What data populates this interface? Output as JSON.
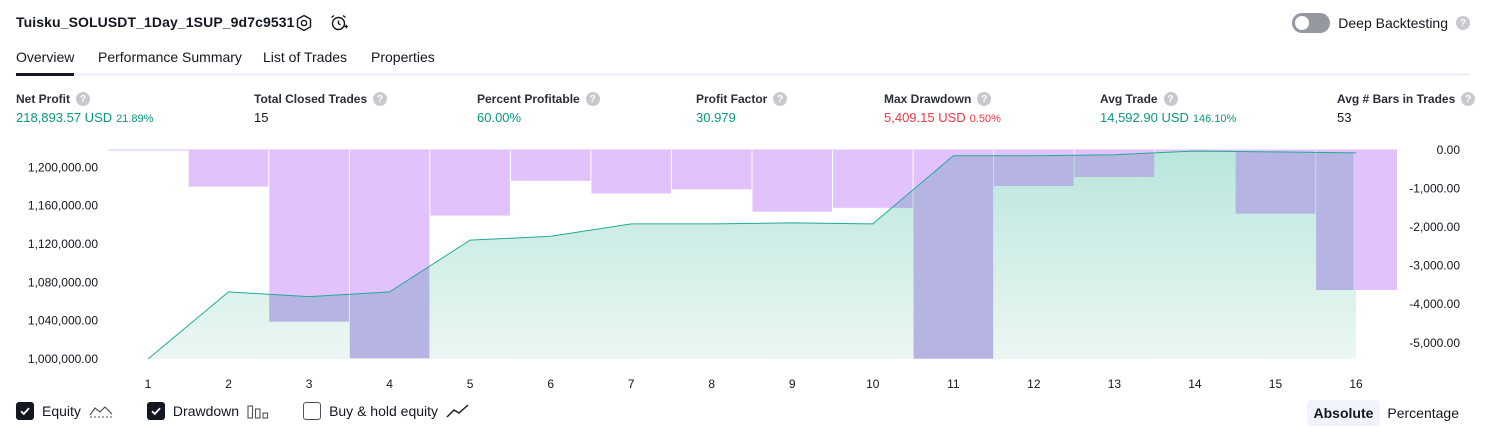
{
  "header": {
    "title": "Tuisku_SOLUSDT_1Day_1SUP_9d7c9531",
    "deep_backtesting_label": "Deep Backtesting",
    "help_glyph": "?"
  },
  "tabs": [
    {
      "label": "Overview"
    },
    {
      "label": "Performance Summary"
    },
    {
      "label": "List of Trades"
    },
    {
      "label": "Properties"
    }
  ],
  "metrics": [
    {
      "label": "Net Profit",
      "value": "218,893.57 USD",
      "pct": "21.89%",
      "tone": "green"
    },
    {
      "label": "Total Closed Trades",
      "value": "15",
      "pct": "",
      "tone": "dark"
    },
    {
      "label": "Percent Profitable",
      "value": "60.00%",
      "pct": "",
      "tone": "green"
    },
    {
      "label": "Profit Factor",
      "value": "30.979",
      "pct": "",
      "tone": "green"
    },
    {
      "label": "Max Drawdown",
      "value": "5,409.15 USD",
      "pct": "0.50%",
      "tone": "red"
    },
    {
      "label": "Avg Trade",
      "value": "14,592.90 USD",
      "pct": "146.10%",
      "tone": "green"
    },
    {
      "label": "Avg # Bars in Trades",
      "value": "53",
      "pct": "",
      "tone": "dark"
    }
  ],
  "legend": {
    "equity_label": "Equity",
    "drawdown_label": "Drawdown",
    "buy_hold_label": "Buy & hold equity",
    "equity_checked": true,
    "drawdown_checked": true,
    "buy_hold_checked": false
  },
  "mode": {
    "absolute_label": "Absolute",
    "percentage_label": "Percentage",
    "selected": "Absolute"
  },
  "colors": {
    "equity_line": "#22ab94",
    "equity_fill_top": "#b9e6dc",
    "equity_fill_bottom": "#ecf7f4",
    "drawdown_bar": "#e1c2fc",
    "overlap_bar": "#b0b3e0"
  },
  "chart_data": {
    "type": "bar",
    "x": [
      "1",
      "2",
      "3",
      "4",
      "5",
      "6",
      "7",
      "8",
      "9",
      "10",
      "11",
      "12",
      "13",
      "14",
      "15",
      "16"
    ],
    "series": [
      {
        "name": "Equity",
        "type": "area",
        "values": [
          1000000,
          1070000,
          1065000,
          1070000,
          1124000,
          1128000,
          1141000,
          1141000,
          1142000,
          1141000,
          1212000,
          1212000,
          1213000,
          1217000,
          1216000,
          1215000
        ]
      },
      {
        "name": "Drawdown",
        "type": "bar",
        "values": [
          0,
          -950,
          -4450,
          -5400,
          -1700,
          -800,
          -1130,
          -1020,
          -1600,
          -1500,
          -5409.15,
          -935,
          -700,
          -50,
          -1650,
          -3630
        ]
      }
    ],
    "y_left": {
      "ticks": [
        "1,000,000.00",
        "1,040,000.00",
        "1,080,000.00",
        "1,120,000.00",
        "1,160,000.00",
        "1,200,000.00"
      ],
      "min": 1000000,
      "max": 1218000
    },
    "y_right": {
      "ticks": [
        "0.00",
        "-1,000.00",
        "-2,000.00",
        "-3,000.00",
        "-4,000.00",
        "-5,000.00"
      ],
      "min": -5420,
      "max": 0
    }
  }
}
